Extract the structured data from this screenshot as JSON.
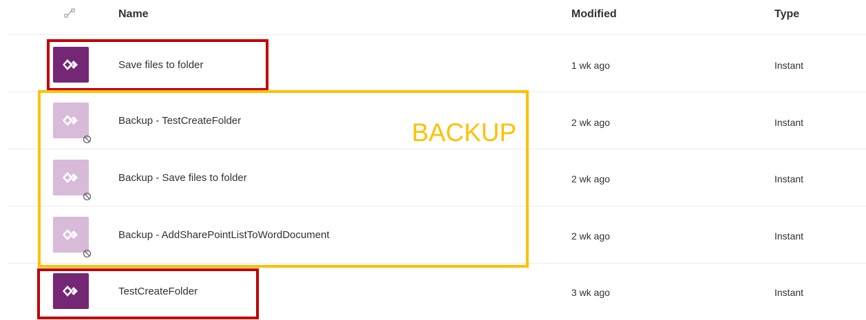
{
  "header": {
    "icon": "flow-type-icon",
    "columns": {
      "name": "Name",
      "modified": "Modified",
      "type": "Type"
    }
  },
  "rows": [
    {
      "name": "Save files to folder",
      "modified": "1 wk ago",
      "type": "Instant",
      "disabled": false
    },
    {
      "name": "Backup - TestCreateFolder",
      "modified": "2 wk ago",
      "type": "Instant",
      "disabled": true
    },
    {
      "name": "Backup - Save files to folder",
      "modified": "2 wk ago",
      "type": "Instant",
      "disabled": true
    },
    {
      "name": "Backup - AddSharePointListToWordDocument",
      "modified": "2 wk ago",
      "type": "Instant",
      "disabled": true
    },
    {
      "name": "TestCreateFolder",
      "modified": "3 wk ago",
      "type": "Instant",
      "disabled": false
    }
  ],
  "annotations": {
    "backup_label": "BACKUP",
    "colors": {
      "highlight_red": "#c00000",
      "highlight_yellow": "#ffc000",
      "flow_icon": "#742774",
      "flow_icon_disabled": "#d8bbd8"
    }
  }
}
